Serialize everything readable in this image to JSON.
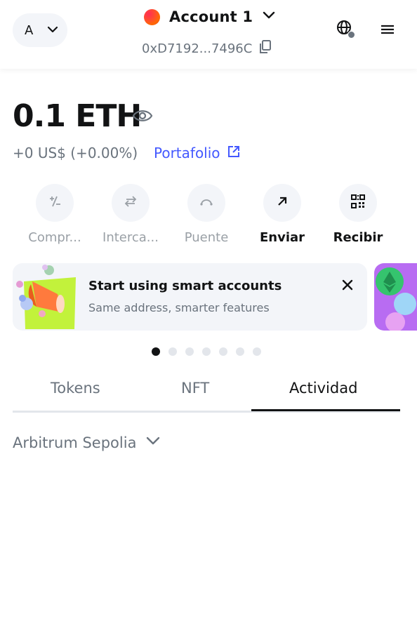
{
  "header": {
    "network_letter": "A",
    "account_name": "Account 1",
    "address": "0xD7192...7496C"
  },
  "balance": {
    "amount": "0.1 ETH",
    "fiat": "+0 US$ (+0.00%)",
    "portfolio_label": "Portafolio"
  },
  "actions": [
    {
      "label": "Compr..."
    },
    {
      "label": "Interca..."
    },
    {
      "label": "Puente"
    },
    {
      "label": "Enviar"
    },
    {
      "label": "Recibir"
    }
  ],
  "banner": {
    "title": "Start using smart accounts",
    "subtitle": "Same address, smarter features"
  },
  "carousel": {
    "count": 7,
    "active_index": 0
  },
  "tabs": [
    {
      "label": "Tokens"
    },
    {
      "label": "NFT"
    },
    {
      "label": "Actividad"
    }
  ],
  "active_tab": "Actividad",
  "network_filter": {
    "label": "Arbitrum Sepolia"
  },
  "colors": {
    "accent": "#4459ff",
    "muted": "#6a737d",
    "text": "#121314",
    "surface": "#f3f5f9"
  }
}
